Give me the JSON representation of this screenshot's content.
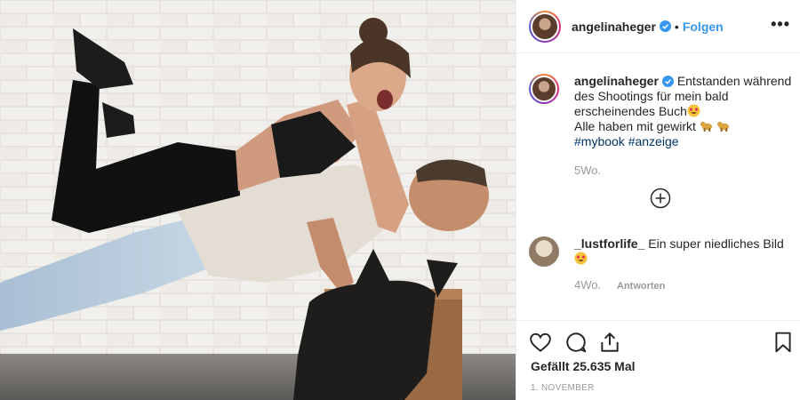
{
  "post": {
    "author": "angelinaheger",
    "follow_label": "Folgen",
    "separator": "•",
    "more_label": "•••"
  },
  "caption": {
    "author": "angelinaheger",
    "line1": "Entstanden während des Shootings für mein bald erscheinendes Buch",
    "line2": "Alle haben mit gewirkt",
    "hashtags": "#mybook #anzeige",
    "age": "5Wo."
  },
  "comment": {
    "author": "_lustforlife_",
    "text": "Ein super niedliches Bild",
    "age": "4Wo.",
    "reply_label": "Antworten"
  },
  "footer": {
    "likes": "Gefällt 25.635 Mal",
    "date": "1. NOVEMBER"
  },
  "icons": {
    "like": "heart-icon",
    "comment": "comment-icon",
    "share": "share-icon",
    "save": "bookmark-icon",
    "load_more": "plus-circle-icon",
    "verified": "verified-badge-icon"
  },
  "colors": {
    "accent": "#3897f0",
    "hashtag": "#003569",
    "muted": "#999999",
    "text": "#262626"
  }
}
